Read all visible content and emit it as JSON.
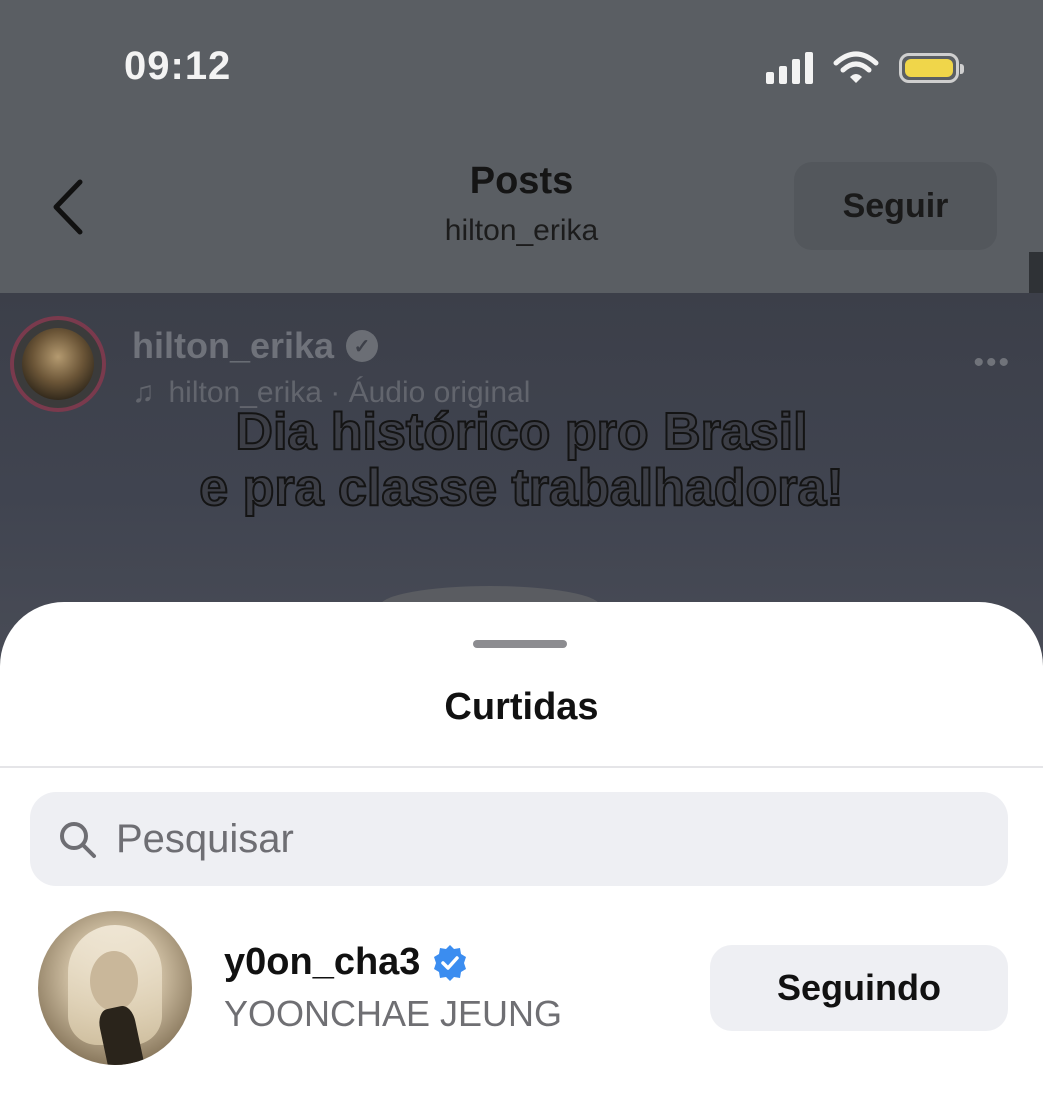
{
  "status_bar": {
    "time": "09:12"
  },
  "nav": {
    "title": "Posts",
    "subtitle": "hilton_erika",
    "follow_label": "Seguir"
  },
  "post": {
    "username": "hilton_erika",
    "audio": "hilton_erika · Áudio original",
    "overlay_line1": "Dia histórico pro Brasil",
    "overlay_line2": "e pra classe trabalhadora!"
  },
  "sheet": {
    "title": "Curtidas",
    "search_placeholder": "Pesquisar",
    "likers": [
      {
        "username": "y0on_cha3",
        "full_name": "YOONCHAE JEUNG",
        "button_label": "Seguindo",
        "verified": true
      }
    ]
  },
  "colors": {
    "verified_blue": "#3b8df0",
    "battery": "#f0d64a",
    "sheet_bg": "#ffffff"
  }
}
